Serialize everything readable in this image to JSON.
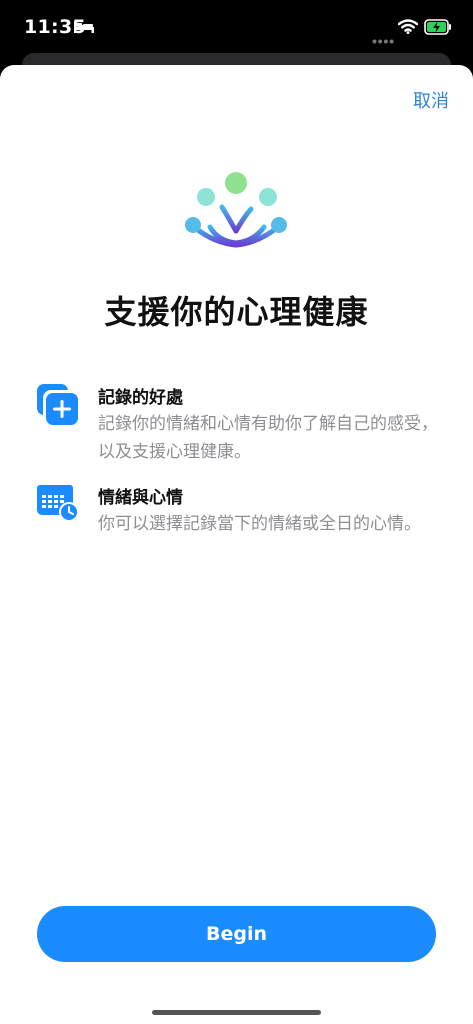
{
  "status_bar": {
    "time": "11:35",
    "icons": [
      "bed-icon",
      "wifi-icon",
      "battery-charging-icon"
    ]
  },
  "header": {
    "cancel_label": "取消"
  },
  "hero": {
    "icon": "mind-tree-icon",
    "title": "支援你的心理健康"
  },
  "features": [
    {
      "icon": "add-stack-icon",
      "title": "記錄的好處",
      "description": "記錄你的情緒和心情有助你了解自己的感受，以及支援心理健康。"
    },
    {
      "icon": "calendar-clock-icon",
      "title": "情緒與心情",
      "description": "你可以選擇記錄當下的情緒或全日的心情。"
    }
  ],
  "actions": {
    "begin_label": "Begin"
  },
  "colors": {
    "accent": "#1a8cff",
    "link": "#2a86d8",
    "secondary_text": "#8e8e93"
  }
}
